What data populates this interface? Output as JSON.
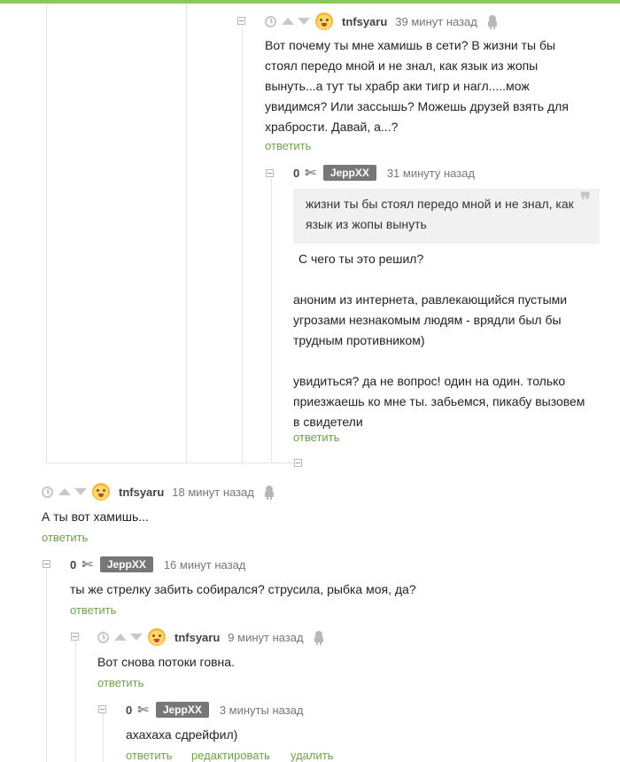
{
  "comments": [
    {
      "author": "tnfsyaru",
      "time": "39 минут назад",
      "lines": [
        "Вот почему ты мне хамишь в сети? В жизни ты бы",
        "стоял передо мной и не знал, как язык из жопы",
        "вынуть...а тут ты храбр аки тигр и нагл.....мож",
        "увидимся? Или зассышь? Можешь друзей взять для",
        "храбрости. Давай, а...?"
      ],
      "reply": "ответить"
    },
    {
      "rating": "0",
      "author": "JeppXX",
      "time": "31 минуту назад",
      "quote_lines": [
        "жизни ты бы стоял передо мной и не знал, как",
        "язык из жопы вынуть"
      ],
      "lines": [
        "С чего ты это решил?",
        "",
        "аноним из интернета, равлекающийся пустыми",
        "угрозами незнакомым людям - врядли был бы",
        "трудным противником)",
        "",
        "увидиться? да не вопрос! один на один. только",
        "приезжаешь ко мне ты. забьемся, пикабу вызовем",
        "в свидетели"
      ],
      "reply": "ответить"
    },
    {
      "author": "tnfsyaru",
      "time": "18 минут назад",
      "lines": [
        "А ты вот хамишь..."
      ],
      "reply": "ответить"
    },
    {
      "rating": "0",
      "author": "JeppXX",
      "time": "16 минут назад",
      "lines": [
        "ты же стрелку забить собирался? струсила, рыбка моя, да?"
      ],
      "reply": "ответить"
    },
    {
      "author": "tnfsyaru",
      "time": "9 минут назад",
      "lines": [
        "Вот снова потоки говна."
      ],
      "reply": "ответить"
    },
    {
      "rating": "0",
      "author": "JeppXX",
      "time": "3 минуты назад",
      "lines": [
        "ахахаха сдрейфил)"
      ],
      "reply": "ответить",
      "edit": "редактировать",
      "delete": "удалить"
    }
  ]
}
